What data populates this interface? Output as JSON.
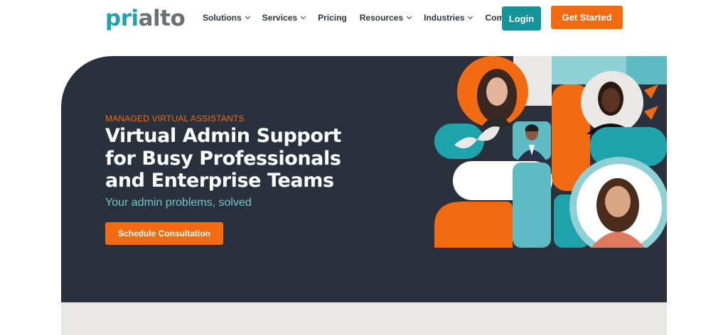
{
  "header": {
    "logo": {
      "part1": "pri",
      "part2": "alto"
    },
    "nav": [
      {
        "label": "Solutions",
        "dropdown": true
      },
      {
        "label": "Services",
        "dropdown": true
      },
      {
        "label": "Pricing",
        "dropdown": false
      },
      {
        "label": "Resources",
        "dropdown": true
      },
      {
        "label": "Industries",
        "dropdown": true
      },
      {
        "label": "Company",
        "dropdown": true
      }
    ],
    "login_label": "Login",
    "get_started_label": "Get Started"
  },
  "hero": {
    "eyebrow": "MANAGED VIRTUAL ASSISTANTS",
    "headline_lines": [
      "Virtual Admin Support",
      "for Busy Professionals",
      "and Enterprise Teams"
    ],
    "subheadline": "Your admin problems, solved",
    "cta_label": "Schedule Consultation"
  },
  "colors": {
    "brand_teal": "#1ea3ad",
    "brand_orange": "#f26b10",
    "hero_bg": "#2b313c",
    "light_teal": "#6fc6cf",
    "light_gray": "#e9e8e4"
  },
  "icons": [
    "chevron-down-icon"
  ]
}
